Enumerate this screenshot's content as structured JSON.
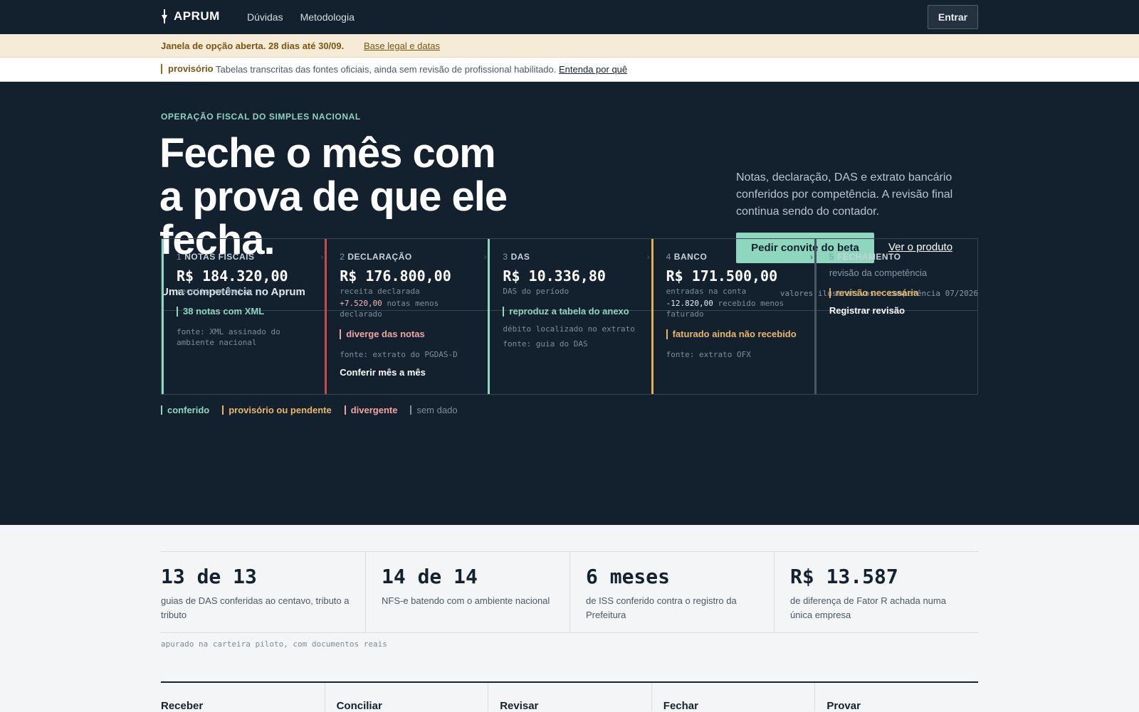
{
  "nav": {
    "brand": "APRUM",
    "links": [
      "Dúvidas",
      "Metodologia"
    ],
    "login": "Entrar"
  },
  "banner": {
    "text": "Janela de opção aberta. 28 dias até 30/09.",
    "link": "Base legal e datas"
  },
  "provisional": {
    "tag": "provisório",
    "text": "Tabelas transcritas das fontes oficiais, ainda sem revisão de profissional habilitado.",
    "link": "Entenda por quê"
  },
  "hero": {
    "eyebrow": "OPERAÇÃO FISCAL DO SIMPLES NACIONAL",
    "title": "Feche o mês com a prova de que ele fecha.",
    "lede": "Notas, declaração, DAS e extrato bancário conferidos por competência. A revisão final continua sendo do contador.",
    "cta_primary": "Pedir convite do beta",
    "cta_secondary": "Ver o produto"
  },
  "competence": {
    "title": "Uma competência no Aprum",
    "note": "valores ilustrativos · competência 07/2026",
    "cards": [
      {
        "n": "1",
        "step": "NOTAS FISCAIS",
        "amount": "R$ 184.320,00",
        "sub": "receita em notas",
        "badge": "38 notas com XML",
        "source": "fonte: XML assinado do ambiente nacional"
      },
      {
        "n": "2",
        "step": "DECLARAÇÃO",
        "amount": "R$ 176.800,00",
        "sub": "receita declarada",
        "delta": "+7.520,00",
        "delta_text": "notas menos declarado",
        "badge": "diverge das notas",
        "source": "fonte: extrato do PGDAS-D",
        "action": "Conferir mês a mês"
      },
      {
        "n": "3",
        "step": "DAS",
        "amount": "R$ 10.336,80",
        "sub": "DAS do período",
        "badge": "reproduz a tabela do anexo",
        "note": "débito localizado no extrato",
        "source": "fonte: guia do DAS"
      },
      {
        "n": "4",
        "step": "BANCO",
        "amount": "R$ 171.500,00",
        "sub": "entradas na conta",
        "delta": "-12.820,00",
        "delta_text": "recebido menos faturado",
        "badge": "faturado ainda não recebido",
        "source": "fonte: extrato OFX"
      },
      {
        "n": "5",
        "step": "FECHAMENTO",
        "plain": "revisão da competência",
        "badge": "revisão necessária",
        "action": "Registrar revisão"
      }
    ]
  },
  "legend": [
    "conferido",
    "provisório ou pendente",
    "divergente",
    "sem dado"
  ],
  "stats": [
    {
      "big": "13 de 13",
      "desc": "guias de DAS conferidas ao centavo, tributo a tributo"
    },
    {
      "big": "14 de 14",
      "desc": "NFS-e batendo com o ambiente nacional"
    },
    {
      "big": "6 meses",
      "desc": "de ISS conferido contra o registro da Prefeitura"
    },
    {
      "big": "R$ 13.587",
      "desc": "de diferença de Fator R achada numa única empresa"
    }
  ],
  "stats_note": "apurado na carteira piloto, com documentos reais",
  "process": [
    "Receber",
    "Conciliar",
    "Revisar",
    "Fechar",
    "Provar"
  ],
  "colors": {
    "navy": "#13212f",
    "mint": "#8fd6bf",
    "amber": "#e3ae5a",
    "red": "#c94a4a"
  }
}
